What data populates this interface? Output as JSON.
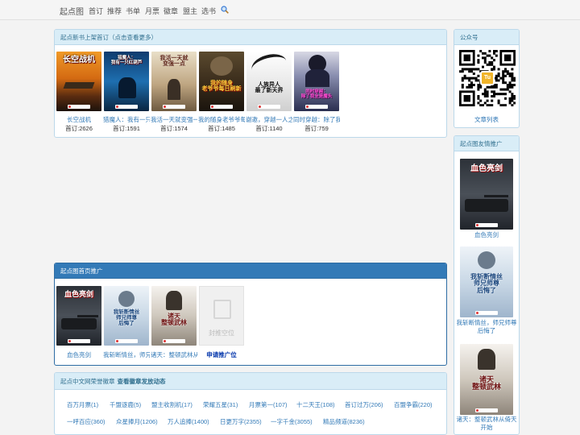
{
  "topnav": {
    "brand": "起点图",
    "links": [
      "首订",
      "推荐",
      "书单",
      "月票",
      "徽章",
      "盟主",
      "选书"
    ]
  },
  "new_books": {
    "title": "起点新书上架首订",
    "hint": "（点击查看更多）",
    "covers": [
      "长空战机",
      "猎魔人：\n我有一只红葫芦",
      "我活一天就\n变强一点",
      "我的随身\n老爷爷每日刷新",
      "人族异人\n最了新天界",
      "同时穿越：\n除了我全是魔头"
    ],
    "items": [
      {
        "name": "长空战机",
        "count": "首订:2626"
      },
      {
        "name": "猎魔人：我有一只",
        "count": "首订:1591"
      },
      {
        "name": "我活一天就变强一",
        "count": "首订:1574"
      },
      {
        "name": "我的随身老爷爷每",
        "count": "首订:1485"
      },
      {
        "name": "谢邀，穿越一人之",
        "count": "首订:1140"
      },
      {
        "name": "同时穿越：除了我",
        "count": "首订:759"
      }
    ]
  },
  "homepage_promo": {
    "title": "起点图首页推广",
    "covers": [
      "血色亮剑",
      "我斩断情丝\n师兄师尊\n后悔了",
      "诸天\n整顿武林"
    ],
    "items": [
      {
        "name": "血色亮剑"
      },
      {
        "name": "我斩断情丝，师兄"
      },
      {
        "name": "诸天：整顿武林从"
      }
    ],
    "vacant_label": "封推空位",
    "apply_label": "申请推广位"
  },
  "badges": {
    "title": "起点中文网荣誉徽章",
    "link": "查看徽章发放动态",
    "items": [
      "百万月票(1)",
      "千盟逐鹿(5)",
      "盟主收割机(17)",
      "荣耀五星(31)",
      "月票第一(107)",
      "十二天王(108)",
      "首订过万(206)",
      "百盟争霸(220)",
      "一呼百应(360)",
      "众星捧月(1206)",
      "万人追捧(1400)",
      "日更万字(2355)",
      "一字千金(3055)",
      "精品频道(8236)"
    ]
  },
  "sidebar": {
    "wechat_title": "公众号",
    "qr_center": "Tu",
    "article_list": "文章列表",
    "friends_title": "起点图友情推广",
    "covers": [
      "血色亮剑",
      "我斩断情丝\n师兄师尊\n后悔了",
      "诸天\n整顿武林"
    ],
    "items": [
      "血色亮剑",
      "我斩断情丝，师兄师尊后悔了",
      "诸天：整顿武林从倚天开始"
    ]
  },
  "colors": {
    "link": "#337ab7",
    "panel_head": "#d9edf7",
    "panel_head_blue": "#337ab7"
  }
}
